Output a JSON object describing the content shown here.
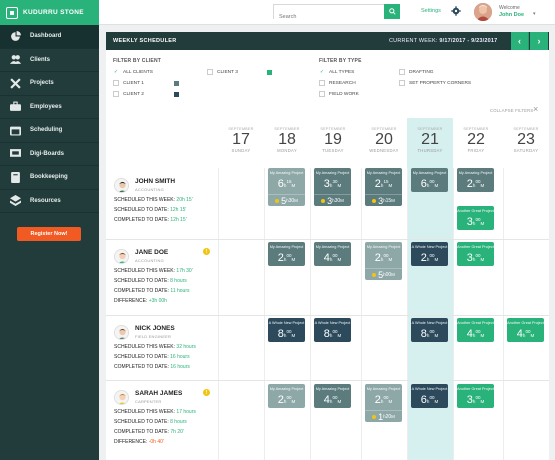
{
  "app": {
    "name": "KUDURRU STONE"
  },
  "nav": [
    {
      "label": "Dashboard",
      "icon": "dashboard-icon",
      "active": true
    },
    {
      "label": "Clients",
      "icon": "users-icon"
    },
    {
      "label": "Projects",
      "icon": "projects-icon"
    },
    {
      "label": "Employees",
      "icon": "employees-icon"
    },
    {
      "label": "Scheduling",
      "icon": "calendar-icon"
    },
    {
      "label": "Digi-Boards",
      "icon": "board-icon"
    },
    {
      "label": "Bookkeeping",
      "icon": "book-icon"
    },
    {
      "label": "Resources",
      "icon": "layers-icon"
    }
  ],
  "register_label": "Register Now!",
  "topbar": {
    "search_placeholder": "Search",
    "settings_label": "Settings",
    "welcome": "Welcome",
    "user_name": "John Doe"
  },
  "scheduler": {
    "title": "WEEKLY SCHEDULER",
    "week_prefix": "CURRENT WEEK:",
    "week_range": "9/17/2017 - 9/23/2017",
    "filter_client_title": "FILTER BY CLIENT",
    "filter_type_title": "FILTER BY TYPE",
    "clients": [
      {
        "label": "ALL CLIENTS",
        "checked": true
      },
      {
        "label": "CLIENT 1",
        "checked": false,
        "color": "#5b7b7d"
      },
      {
        "label": "CLIENT 2",
        "checked": false,
        "color": "#2c4a5c"
      },
      {
        "label": "CLIENT 3",
        "checked": false,
        "color": "#2ab27b"
      }
    ],
    "types": [
      {
        "label": "ALL TYPES",
        "checked": true
      },
      {
        "label": "RESEARCH",
        "checked": false
      },
      {
        "label": "FIELD WORK",
        "checked": false
      },
      {
        "label": "DRAFTING",
        "checked": false
      },
      {
        "label": "SET PROPERTY CORNERS",
        "checked": false
      }
    ],
    "collapse_label": "COLLAPSE FILTERS",
    "days": [
      {
        "month": "SEPTEMBER",
        "num": "17",
        "name": "SUNDAY"
      },
      {
        "month": "SEPTEMBER",
        "num": "18",
        "name": "MONDAY"
      },
      {
        "month": "SEPTEMBER",
        "num": "19",
        "name": "TUESDAY"
      },
      {
        "month": "SEPTEMBER",
        "num": "20",
        "name": "WEDNESDAY"
      },
      {
        "month": "SEPTEMBER",
        "num": "21",
        "name": "THURSDAY"
      },
      {
        "month": "SEPTEMBER",
        "num": "22",
        "name": "FRIDAY"
      },
      {
        "month": "SEPTEMBER",
        "num": "23",
        "name": "SATURDAY"
      }
    ],
    "people": [
      {
        "name": "JOHN SMITH",
        "role": "ACCOUNTING",
        "warning": false,
        "stats": [
          {
            "label": "SCHEDULED THIS WEEK:",
            "value": "20h 15'"
          },
          {
            "label": "SCHEDULED TO DATE:",
            "value": "12h 15'"
          },
          {
            "label": "COMPLETED TO DATE:",
            "value": "12h 15'"
          }
        ]
      },
      {
        "name": "JANE DOE",
        "role": "ACCOUNTING",
        "warning": true,
        "stats": [
          {
            "label": "SCHEDULED THIS WEEK:",
            "value": "17h 30'"
          },
          {
            "label": "SCHEDULED TO DATE:",
            "value": "8 hours"
          },
          {
            "label": "COMPLETED TO DATE:",
            "value": "11 hours"
          },
          {
            "label": "DIFFERENCE:",
            "value": "+3h 00h"
          }
        ]
      },
      {
        "name": "NICK JONES",
        "role": "FIELD ENGINEER",
        "warning": false,
        "stats": [
          {
            "label": "SCHEDULED THIS WEEK:",
            "value": "32 hours"
          },
          {
            "label": "SCHEDULED TO DATE:",
            "value": "16 hours"
          },
          {
            "label": "COMPLETED TO DATE:",
            "value": "16 hours"
          }
        ]
      },
      {
        "name": "SARAH JAMES",
        "role": "CARPENTER",
        "warning": true,
        "stats": [
          {
            "label": "SCHEDULED THIS WEEK:",
            "value": "17 hours"
          },
          {
            "label": "SCHEDULED TO DATE:",
            "value": "8 hours"
          },
          {
            "label": "COMPLETED TO DATE:",
            "value": "7h 20'"
          },
          {
            "label": "DIFFERENCE:",
            "value": "-0h 40'",
            "negative": true
          }
        ]
      }
    ],
    "cards": {
      "r0d1": {
        "title": "My Amazing Project",
        "h": "6",
        "m": "15",
        "kind": "draft",
        "sub_h": "5",
        "sub_m": "30"
      },
      "r0d2": {
        "title": "My Amazing Project",
        "h": "3",
        "m": "30",
        "kind": "field",
        "sub_h": "3",
        "sub_m": "30"
      },
      "r0d3": {
        "title": "My Amazing Project",
        "h": "2",
        "m": "15",
        "kind": "field",
        "sub_h": "3",
        "sub_m": "15"
      },
      "r0d4": {
        "title": "My Amazing Project",
        "h": "6",
        "m": "00",
        "kind": "field"
      },
      "r0d5a": {
        "title": "My Amazing Project",
        "h": "2",
        "m": "00",
        "kind": "field"
      },
      "r0d5b": {
        "title": "Another Great Project",
        "h": "3",
        "m": "00",
        "kind": "great"
      },
      "r1d1": {
        "title": "My Amazing Project",
        "h": "2",
        "m": "00",
        "kind": "field"
      },
      "r1d2": {
        "title": "My Amazing Project",
        "h": "4",
        "m": "00",
        "kind": "field"
      },
      "r1d3": {
        "title": "My Amazing Project",
        "h": "2",
        "m": "00",
        "kind": "draft",
        "sub_h": "5",
        "sub_m": "00"
      },
      "r1d4": {
        "title": "A Whole New Project",
        "h": "2",
        "m": "00",
        "kind": "new"
      },
      "r1d5": {
        "title": "Another Great Project",
        "h": "3",
        "m": "00",
        "kind": "great"
      },
      "r2d1": {
        "title": "A Whole New Project",
        "h": "8",
        "m": "00",
        "kind": "new"
      },
      "r2d2": {
        "title": "A Whole New Project",
        "h": "8",
        "m": "00",
        "kind": "new"
      },
      "r2d4": {
        "title": "A Whole New Project",
        "h": "8",
        "m": "00",
        "kind": "new"
      },
      "r2d5": {
        "title": "Another Great Project",
        "h": "4",
        "m": "00",
        "kind": "great"
      },
      "r2d6": {
        "title": "Another Great Project",
        "h": "4",
        "m": "00",
        "kind": "great"
      },
      "r3d1": {
        "title": "My Amazing Project",
        "h": "2",
        "m": "00",
        "kind": "draft"
      },
      "r3d2": {
        "title": "My Amazing Project",
        "h": "4",
        "m": "00",
        "kind": "field"
      },
      "r3d3": {
        "title": "My Amazing Project",
        "h": "2",
        "m": "00",
        "kind": "draft",
        "sub_h": "1",
        "sub_m": "20"
      },
      "r3d4": {
        "title": "A Whole New Project",
        "h": "6",
        "m": "00",
        "kind": "new"
      },
      "r3d5": {
        "title": "Another Great Project",
        "h": "3",
        "m": "00",
        "kind": "great"
      }
    }
  }
}
